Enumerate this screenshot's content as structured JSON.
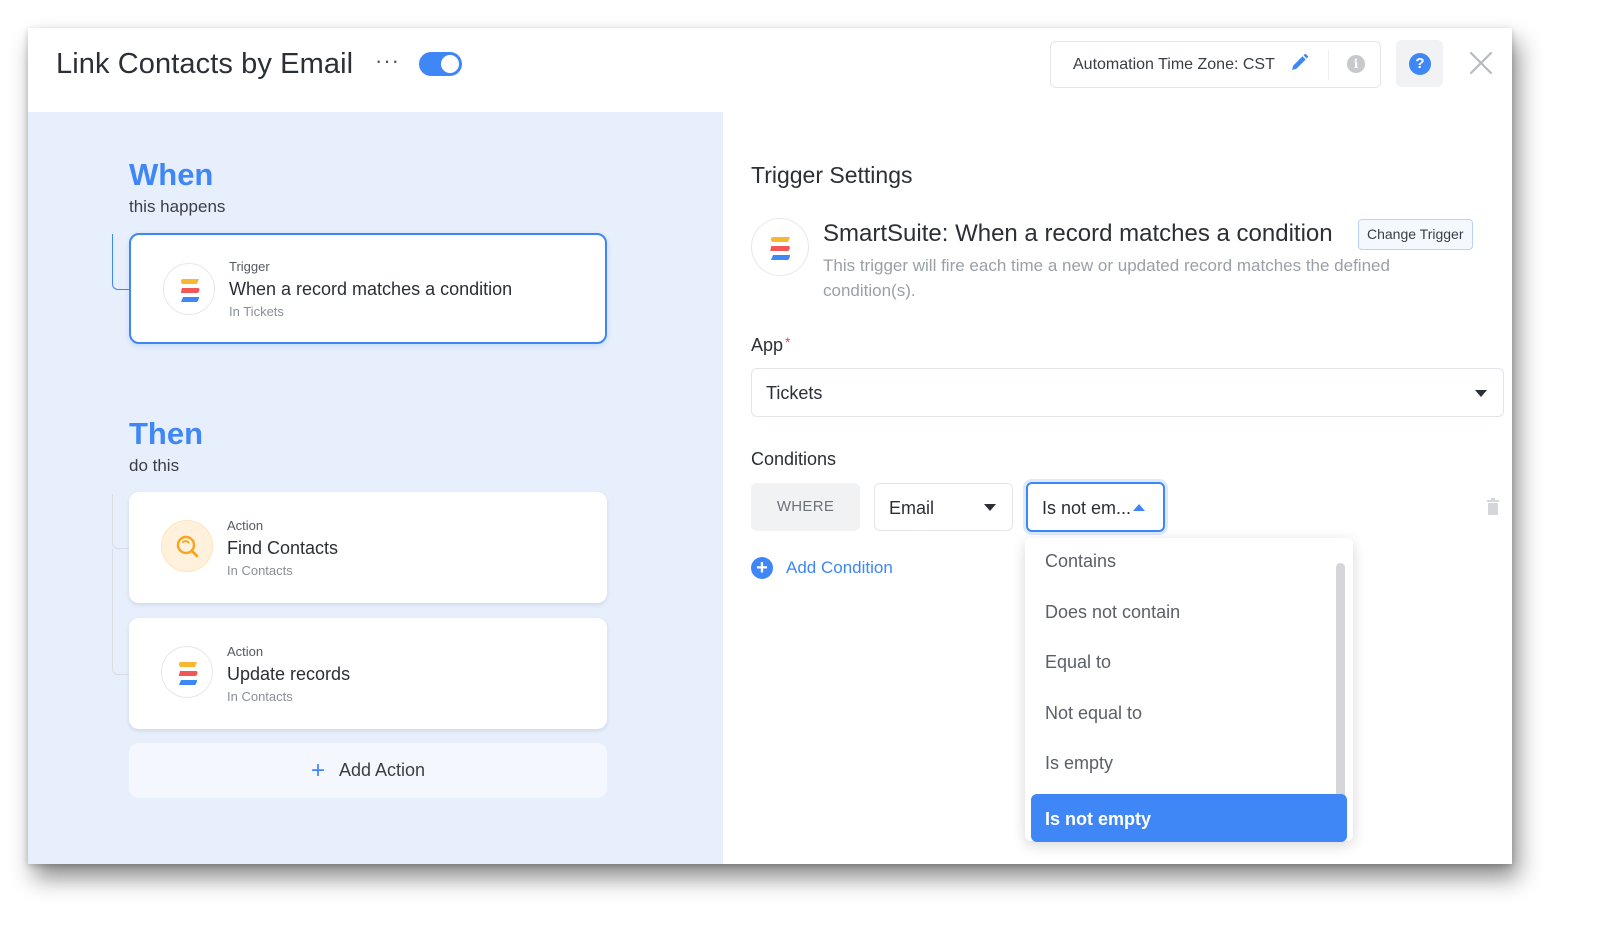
{
  "header": {
    "title": "Link Contacts by Email",
    "more_icon": "ellipsis-icon",
    "more_label": "···",
    "enabled": true,
    "timezone_label": "Automation Time Zone: CST",
    "edit_icon": "pencil-icon",
    "info_icon": "info-icon",
    "info_glyph": "i",
    "help_icon": "question-icon",
    "help_glyph": "?",
    "close_icon": "close-icon"
  },
  "left": {
    "when_title": "When",
    "when_sub": "this happens",
    "trigger": {
      "kind": "Trigger",
      "name": "When a record matches a condition",
      "location": "In Tickets",
      "icon": "smartsuite-logo-icon"
    },
    "then_title": "Then",
    "then_sub": "do this",
    "actions": [
      {
        "kind": "Action",
        "name": "Find Contacts",
        "location": "In Contacts",
        "icon": "search-icon"
      },
      {
        "kind": "Action",
        "name": "Update records",
        "location": "In Contacts",
        "icon": "smartsuite-logo-icon"
      }
    ],
    "add_action_label": "Add Action",
    "add_action_glyph": "+"
  },
  "right": {
    "title": "Trigger Settings",
    "trigger_brand": "SmartSuite:",
    "trigger_name": "When a record matches a condition",
    "change_trigger_label": "Change Trigger",
    "description": "This trigger will fire each time a new or updated record matches the defined condition(s).",
    "app_label": "App",
    "app_required_mark": "*",
    "app_value": "Tickets",
    "conditions_label": "Conditions",
    "where_label": "WHERE",
    "field_value": "Email",
    "operator_value": "Is not em...",
    "add_condition_label": "Add Condition",
    "add_condition_glyph": "+",
    "operator_options": [
      {
        "label": "Contains",
        "selected": false
      },
      {
        "label": "Does not contain",
        "selected": false
      },
      {
        "label": "Equal to",
        "selected": false
      },
      {
        "label": "Not equal to",
        "selected": false
      },
      {
        "label": "Is empty",
        "selected": false
      },
      {
        "label": "Is not empty",
        "selected": true
      }
    ]
  },
  "colors": {
    "accent": "#3f86f7",
    "left_panel_bg": "#e8effc",
    "logo_yellow": "#f7b733",
    "logo_red": "#f25757",
    "logo_blue": "#3f86f7",
    "search_orange": "#f5a623"
  }
}
